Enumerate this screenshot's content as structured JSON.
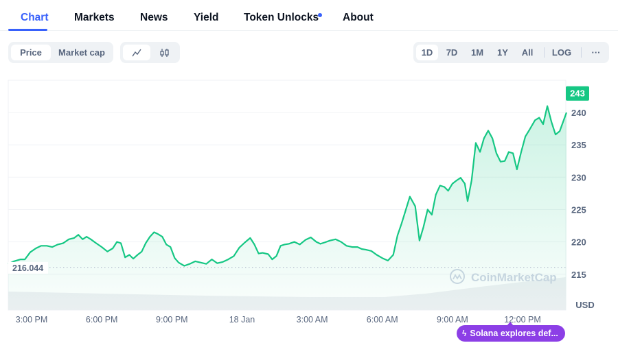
{
  "tabs": [
    {
      "label": "Chart",
      "active": true
    },
    {
      "label": "Markets",
      "active": false
    },
    {
      "label": "News",
      "active": false
    },
    {
      "label": "Yield",
      "active": false
    },
    {
      "label": "Token Unlocks",
      "active": false,
      "has_dot": true
    },
    {
      "label": "About",
      "active": false
    }
  ],
  "toolbar": {
    "metric_toggle": [
      {
        "label": "Price",
        "selected": true
      },
      {
        "label": "Market cap",
        "selected": false
      }
    ],
    "chart_type_toggle": [
      {
        "icon": "line-chart-icon",
        "glyph": "〰",
        "selected": true
      },
      {
        "icon": "candlestick-icon",
        "glyph": "ɸ",
        "selected": false
      }
    ],
    "ranges": [
      {
        "label": "1D",
        "selected": true
      },
      {
        "label": "7D",
        "selected": false
      },
      {
        "label": "1M",
        "selected": false
      },
      {
        "label": "1Y",
        "selected": false
      },
      {
        "label": "All",
        "selected": false
      }
    ],
    "log_label": "LOG",
    "more_label": "···"
  },
  "colors": {
    "accent": "#3861fb",
    "line": "#16c784",
    "news_badge": "#8c3fe6",
    "text_muted": "#58667e"
  },
  "watermark": "CoinMarketCap",
  "news_badge": {
    "icon": "lightning-icon",
    "glyph": "ϟ",
    "label": "Solana explores def..."
  },
  "chart_data": {
    "type": "area",
    "title": "",
    "xlabel": "",
    "ylabel": "USD",
    "currency_label": "USD",
    "current_price_label": "243",
    "open_price_label": "216.044",
    "open_price": 216.044,
    "ylim": [
      213.5,
      243.5
    ],
    "yticks": [
      215,
      220,
      225,
      230,
      235,
      240
    ],
    "ytick_labels": [
      "215",
      "220",
      "225",
      "230",
      "235",
      "240"
    ],
    "xlim_hours": [
      0,
      23.85
    ],
    "xticks_hours": [
      1,
      4,
      7,
      10,
      13,
      16,
      19,
      22
    ],
    "xtick_labels": [
      "3:00 PM",
      "6:00 PM",
      "9:00 PM",
      "18 Jan",
      "3:00 AM",
      "6:00 AM",
      "9:00 AM",
      "12:00 PM"
    ],
    "grid": true,
    "series": [
      {
        "name": "Price",
        "x_hours": [
          0,
          0.24,
          0.53,
          0.71,
          0.94,
          1.18,
          1.41,
          1.65,
          1.88,
          2.12,
          2.35,
          2.59,
          2.82,
          3.0,
          3.18,
          3.35,
          3.53,
          3.76,
          4.0,
          4.24,
          4.47,
          4.65,
          4.82,
          5.0,
          5.18,
          5.35,
          5.53,
          5.71,
          5.88,
          6.06,
          6.24,
          6.41,
          6.59,
          6.76,
          6.94,
          7.12,
          7.29,
          7.53,
          7.76,
          8.0,
          8.24,
          8.47,
          8.71,
          8.94,
          9.18,
          9.41,
          9.65,
          9.88,
          10.12,
          10.35,
          10.53,
          10.71,
          10.88,
          11.12,
          11.29,
          11.47,
          11.65,
          11.82,
          12.0,
          12.24,
          12.47,
          12.71,
          12.94,
          13.18,
          13.35,
          13.53,
          13.76,
          14.0,
          14.24,
          14.47,
          14.71,
          14.94,
          15.12,
          15.29,
          15.53,
          15.76,
          16.0,
          16.24,
          16.47,
          16.65,
          16.82,
          17.0,
          17.18,
          17.41,
          17.59,
          17.76,
          17.94,
          18.12,
          18.29,
          18.47,
          18.65,
          18.82,
          19.0,
          19.18,
          19.35,
          19.53,
          19.65,
          19.82,
          20.0,
          20.18,
          20.35,
          20.53,
          20.71,
          20.88,
          21.06,
          21.24,
          21.41,
          21.59,
          21.76,
          21.94,
          22.12,
          22.29,
          22.53,
          22.71,
          22.88,
          23.06,
          23.24,
          23.41,
          23.59,
          23.76,
          23.88
        ],
        "values": [
          216.6,
          217.0,
          217.3,
          217.3,
          218.4,
          219.0,
          219.4,
          219.4,
          219.2,
          219.6,
          219.8,
          220.4,
          220.6,
          221.1,
          220.4,
          220.8,
          220.4,
          219.8,
          219.2,
          218.5,
          219.0,
          220.0,
          219.8,
          217.6,
          218.0,
          217.4,
          218.0,
          218.5,
          219.8,
          220.8,
          221.5,
          221.2,
          220.8,
          219.6,
          219.2,
          217.5,
          216.8,
          216.3,
          216.6,
          217.0,
          216.8,
          216.6,
          217.3,
          216.7,
          216.9,
          217.3,
          217.8,
          219.1,
          219.9,
          220.6,
          219.6,
          218.2,
          218.3,
          218.1,
          217.3,
          217.8,
          219.4,
          219.6,
          219.7,
          220.0,
          219.6,
          220.3,
          220.7,
          220.0,
          219.7,
          219.9,
          220.2,
          220.4,
          220.0,
          219.4,
          219.2,
          219.2,
          218.9,
          218.8,
          218.6,
          218.0,
          217.5,
          217.1,
          218.0,
          221.0,
          222.8,
          224.9,
          227.0,
          225.5,
          220.2,
          222.3,
          225.0,
          224.2,
          227.3,
          228.7,
          228.5,
          227.9,
          229.0,
          229.5,
          229.9,
          229.0,
          226.3,
          229.5,
          235.3,
          233.9,
          236.0,
          237.2,
          236.0,
          233.7,
          232.4,
          232.5,
          233.9,
          233.7,
          231.2,
          233.9,
          236.3,
          237.3,
          238.8,
          239.2,
          238.2,
          241.0,
          238.5,
          236.6,
          237.1,
          238.8,
          240.0,
          243.0
        ]
      }
    ],
    "volume_note": "volume band shown below price line"
  }
}
